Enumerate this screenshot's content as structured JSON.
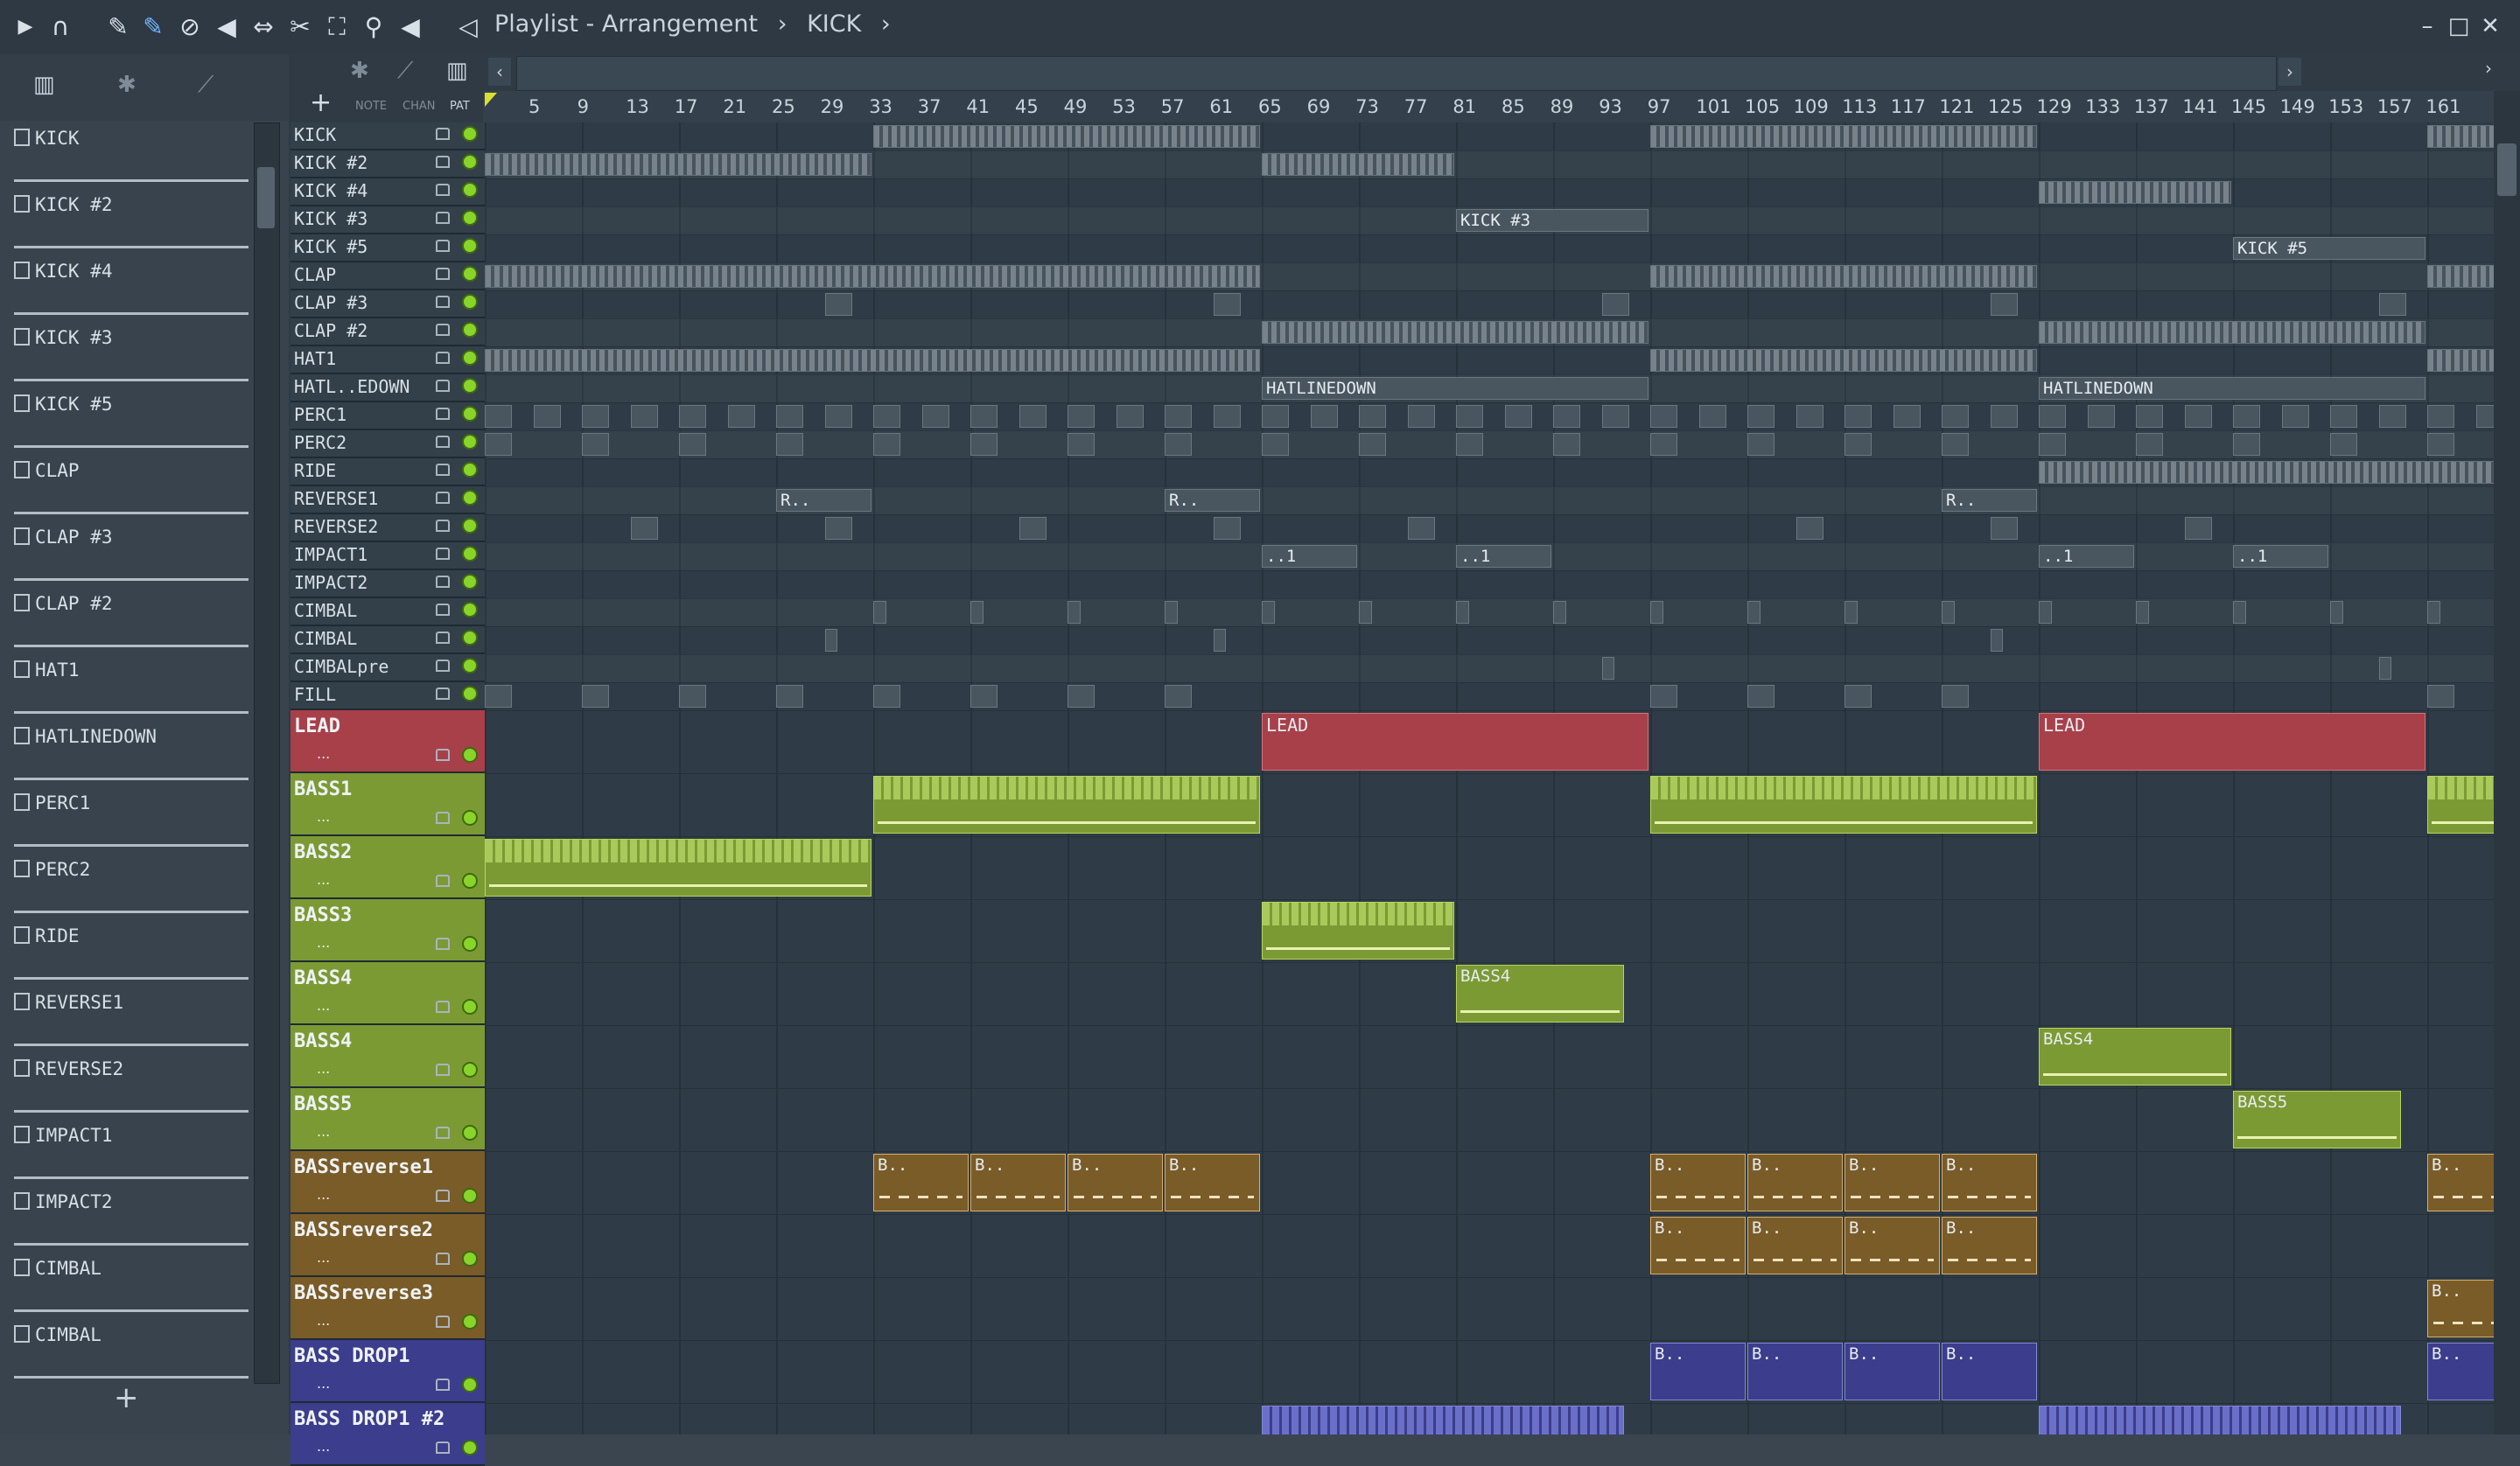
{
  "titlebar": {
    "breadcrumb": [
      "Playlist - Arrangement",
      "›",
      "KICK",
      "›"
    ],
    "window_buttons": [
      "–",
      "□",
      "✕"
    ]
  },
  "toolbar": {
    "left_icons": [
      "play-arrow-icon",
      "magnet-icon",
      "pencil-icon",
      "paint-icon",
      "delete-icon",
      "mute-icon",
      "slip-icon",
      "slice-icon",
      "select-icon",
      "zoom-icon",
      "playback-icon"
    ],
    "labels": [
      "NOTE",
      "CHAN",
      "PAT"
    ]
  },
  "browser": {
    "items": [
      "KICK",
      "KICK #2",
      "KICK #4",
      "KICK #3",
      "KICK #5",
      "CLAP",
      "CLAP #3",
      "CLAP #2",
      "HAT1",
      "HATLINEDOWN",
      "PERC1",
      "PERC2",
      "RIDE",
      "REVERSE1",
      "REVERSE2",
      "IMPACT1",
      "IMPACT2",
      "CIMBAL",
      "CIMBAL"
    ],
    "add_label": "+"
  },
  "ruler": {
    "ticks": [
      "5",
      "9",
      "13",
      "17",
      "21",
      "25",
      "29",
      "33",
      "37",
      "41",
      "45",
      "49",
      "53",
      "57",
      "61",
      "65",
      "69",
      "73",
      "77",
      "81",
      "85",
      "89",
      "93",
      "97",
      "101",
      "105",
      "109",
      "113",
      "117",
      "121",
      "125",
      "129",
      "133",
      "137",
      "141",
      "145",
      "149",
      "153",
      "157",
      "161"
    ]
  },
  "tracks": {
    "small": [
      "KICK",
      "KICK #2",
      "KICK #4",
      "KICK #3",
      "KICK #5",
      "CLAP",
      "CLAP #3",
      "CLAP #2",
      "HAT1",
      "HATL..EDOWN",
      "PERC1",
      "PERC2",
      "RIDE",
      "REVERSE1",
      "REVERSE2",
      "IMPACT1",
      "IMPACT2",
      "CIMBAL",
      "CIMBAL",
      "CIMBALpre",
      "FILL"
    ],
    "big": [
      "LEAD",
      "BASS1",
      "BASS2",
      "BASS3",
      "BASS4",
      "BASS4",
      "BASS5",
      "BASSreverse1",
      "BASSreverse2",
      "BASSreverse3",
      "BASS DROP1",
      "BASS DROP1 #2"
    ],
    "big_colors": [
      "#a8404a",
      "#7c9a34",
      "#7c9a34",
      "#7c9a34",
      "#7c9a34",
      "#7c9a34",
      "#7c9a34",
      "#7a5c28",
      "#7a5c28",
      "#7a5c28",
      "#3c3d8c",
      "#3c3d8c"
    ],
    "dots": "..."
  },
  "clips": {
    "kick3": "KICK #3",
    "kick5": "KICK #5",
    "hatlinedown": "HATLINEDOWN",
    "reverse_r": "R..",
    "impact": "..1",
    "lead": "LEAD",
    "bass4": "BASS4",
    "bass5": "BASS5",
    "b_short": "B.."
  }
}
